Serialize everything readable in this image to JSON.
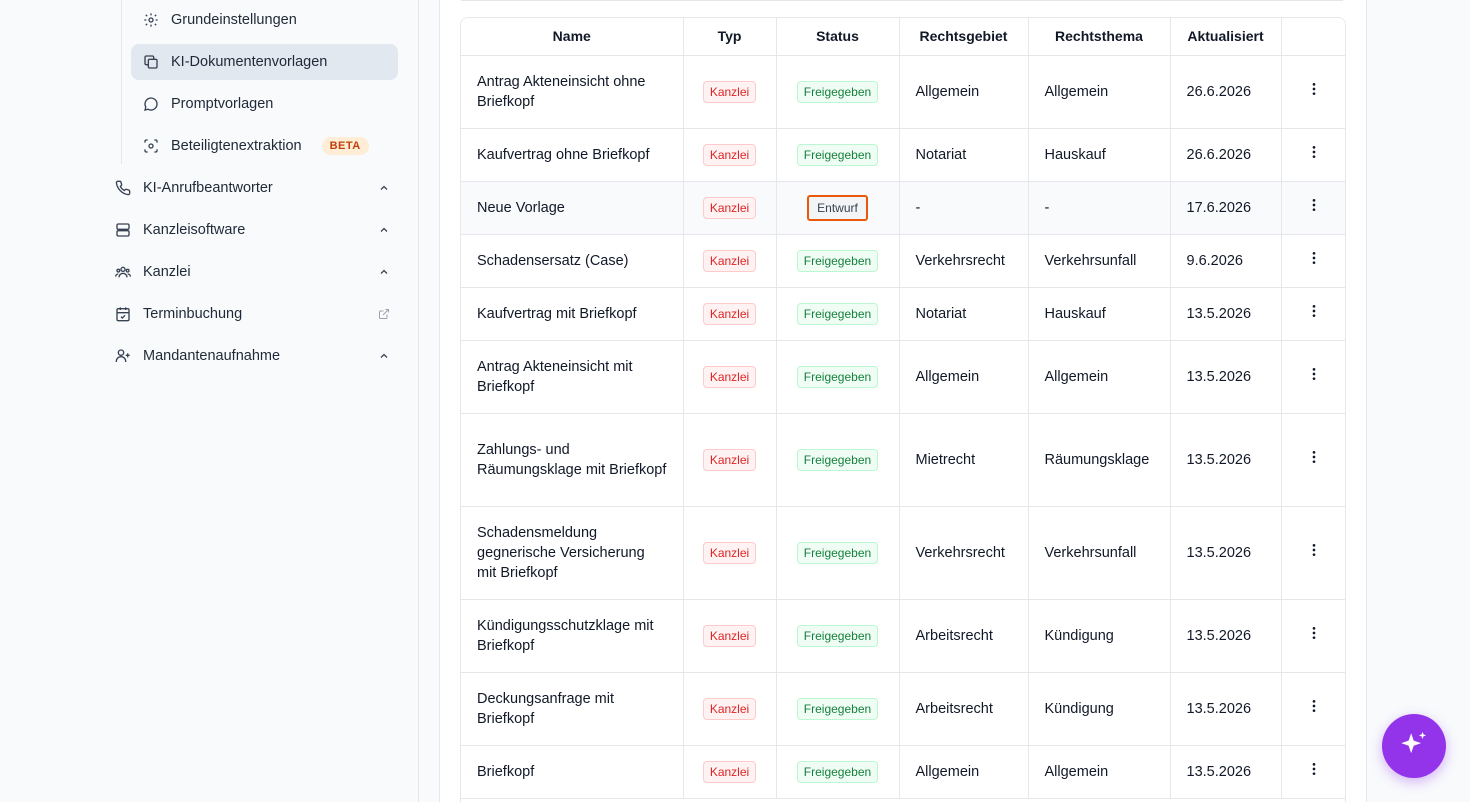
{
  "sidebar": {
    "sub_items": [
      {
        "label": "Grundeinstellungen",
        "icon": "gear-icon"
      },
      {
        "label": "KI-Dokumentenvorlagen",
        "icon": "copy-icon",
        "active": true
      },
      {
        "label": "Promptvorlagen",
        "icon": "chat-bubble-icon"
      },
      {
        "label": "Beteiligtenextraktion",
        "icon": "scan-face-icon",
        "badge": "BETA"
      }
    ],
    "items": [
      {
        "label": "KI-Anrufbeantworter",
        "icon": "phone-icon",
        "trail": "chevron-up-icon"
      },
      {
        "label": "Kanzleisoftware",
        "icon": "server-icon",
        "trail": "chevron-up-icon"
      },
      {
        "label": "Kanzlei",
        "icon": "users-icon",
        "trail": "chevron-up-icon"
      },
      {
        "label": "Terminbuchung",
        "icon": "calendar-icon",
        "trail": "external-link-icon"
      },
      {
        "label": "Mandantenaufnahme",
        "icon": "user-plus-icon",
        "trail": "chevron-up-icon"
      }
    ]
  },
  "table": {
    "headers": [
      "Name",
      "Typ",
      "Status",
      "Rechtsgebiet",
      "Rechtsthema",
      "Aktualisiert",
      ""
    ],
    "rows": [
      {
        "name": "Antrag Akteneinsicht ohne Briefkopf",
        "typ": "Kanzlei",
        "status": "Freigegeben",
        "gebiet": "Allgemein",
        "thema": "Allgemein",
        "date": "26.6.2026"
      },
      {
        "name": "Kaufvertrag ohne Briefkopf",
        "typ": "Kanzlei",
        "status": "Freigegeben",
        "gebiet": "Notariat",
        "thema": "Hauskauf",
        "date": "26.6.2026"
      },
      {
        "name": "Neue Vorlage",
        "typ": "Kanzlei",
        "status": "Entwurf",
        "gebiet": "-",
        "thema": "-",
        "date": "17.6.2026"
      },
      {
        "name": "Schadensersatz (Case)",
        "typ": "Kanzlei",
        "status": "Freigegeben",
        "gebiet": "Verkehrsrecht",
        "thema": "Verkehrsunfall",
        "date": "9.6.2026"
      },
      {
        "name": "Kaufvertrag mit Briefkopf",
        "typ": "Kanzlei",
        "status": "Freigegeben",
        "gebiet": "Notariat",
        "thema": "Hauskauf",
        "date": "13.5.2026"
      },
      {
        "name": "Antrag Akteneinsicht mit Briefkopf",
        "typ": "Kanzlei",
        "status": "Freigegeben",
        "gebiet": "Allgemein",
        "thema": "Allgemein",
        "date": "13.5.2026"
      },
      {
        "name": "Zahlungs- und Räumungsklage mit Briefkopf",
        "typ": "Kanzlei",
        "status": "Freigegeben",
        "gebiet": "Mietrecht",
        "thema": "Räumungsklage",
        "date": "13.5.2026"
      },
      {
        "name": "Schadensmeldung gegnerische Versicherung mit Briefkopf",
        "typ": "Kanzlei",
        "status": "Freigegeben",
        "gebiet": "Verkehrsrecht",
        "thema": "Verkehrsunfall",
        "date": "13.5.2026"
      },
      {
        "name": "Kündigungsschutzklage mit Briefkopf",
        "typ": "Kanzlei",
        "status": "Freigegeben",
        "gebiet": "Arbeitsrecht",
        "thema": "Kündigung",
        "date": "13.5.2026"
      },
      {
        "name": "Deckungsanfrage mit Briefkopf",
        "typ": "Kanzlei",
        "status": "Freigegeben",
        "gebiet": "Arbeitsrecht",
        "thema": "Kündigung",
        "date": "13.5.2026"
      },
      {
        "name": "Briefkopf",
        "typ": "Kanzlei",
        "status": "Freigegeben",
        "gebiet": "Allgemein",
        "thema": "Allgemein",
        "date": "13.5.2026"
      }
    ]
  },
  "fab": {
    "icon": "sparkle-icon"
  },
  "colors": {
    "accent": "#9333ea",
    "active_bg": "#e2e8f0",
    "kanzlei": "#dc2626",
    "freigegeben": "#15803d",
    "entwurf_border": "#ea580c"
  }
}
